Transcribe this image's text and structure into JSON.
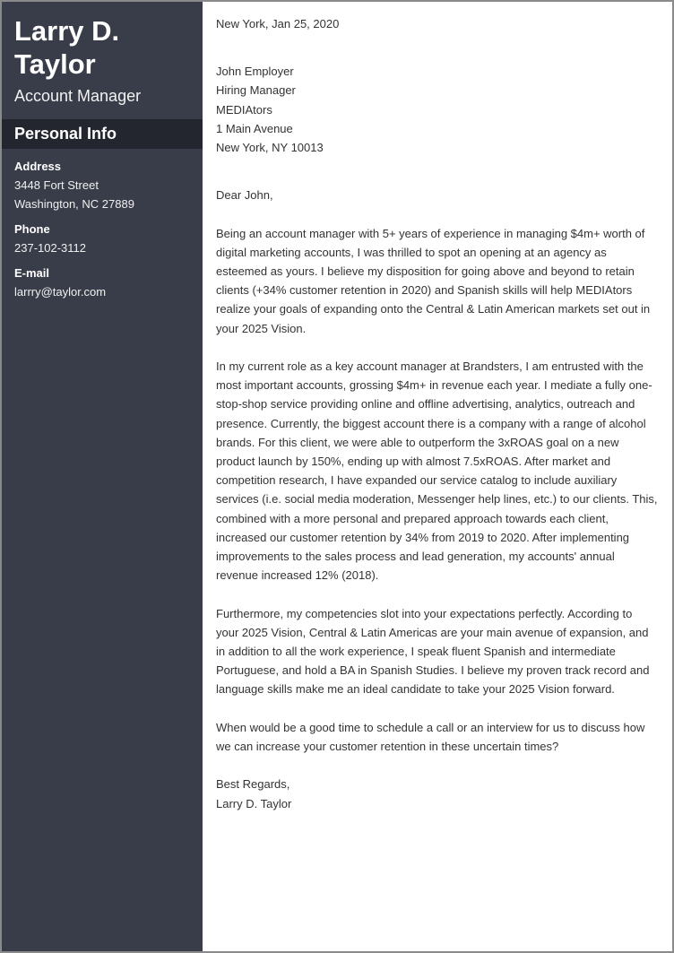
{
  "sidebar": {
    "name_line1": "Larry D.",
    "name_line2": "Taylor",
    "role": "Account Manager",
    "section_title": "Personal Info",
    "address_label": "Address",
    "address_line1": "3448 Fort Street",
    "address_line2": "Washington, NC 27889",
    "phone_label": "Phone",
    "phone_value": "237-102-3112",
    "email_label": "E-mail",
    "email_value": "larrry@taylor.com"
  },
  "letter": {
    "date": "New York, Jan 25, 2020",
    "recipient": [
      "John Employer",
      "Hiring Manager",
      "MEDIAtors",
      "1 Main Avenue",
      "New York, NY 10013"
    ],
    "salutation": "Dear John,",
    "paragraphs": [
      "Being an account manager with 5+ years of experience in managing $4m+ worth of digital marketing accounts, I was thrilled to spot an opening at an agency as esteemed as yours. I believe my disposition for going above and beyond to retain clients (+34% customer retention in 2020) and Spanish skills will help MEDIAtors realize your goals of expanding onto the Central & Latin American markets set out in your 2025 Vision.",
      "In my current role as a key account manager at Brandsters, I am entrusted with the most important accounts, grossing $4m+ in revenue each year. I mediate a fully one-stop-shop service providing online and offline advertising, analytics, outreach and presence. Currently, the biggest account there is a company with a range of alcohol brands. For this client, we were able to outperform the 3xROAS goal on a new product launch by 150%, ending up with almost 7.5xROAS. After market and competition research, I have expanded our service catalog to include auxiliary services (i.e. social media moderation, Messenger help lines, etc.) to our clients. This, combined with a more personal and prepared approach towards each client, increased our customer retention by 34% from 2019 to 2020. After implementing improvements to the sales process and lead generation, my accounts' annual revenue increased 12% (2018).",
      "Furthermore, my competencies slot into your expectations perfectly. According to your 2025 Vision, Central & Latin Americas are your main avenue of expansion, and in addition to all the work experience, I speak fluent Spanish and intermediate Portuguese, and hold a BA in Spanish Studies. I believe my proven track record and language skills make me an ideal candidate to take your 2025 Vision forward.",
      "When would be a good time to schedule a call or an interview for us to discuss how we can increase your customer retention in these uncertain times?"
    ],
    "closing": "Best Regards,",
    "signature": "Larry D. Taylor"
  },
  "colors": {
    "sidebar_bg": "#383d49",
    "section_header_bg": "#23262f",
    "body_text": "#333333"
  }
}
